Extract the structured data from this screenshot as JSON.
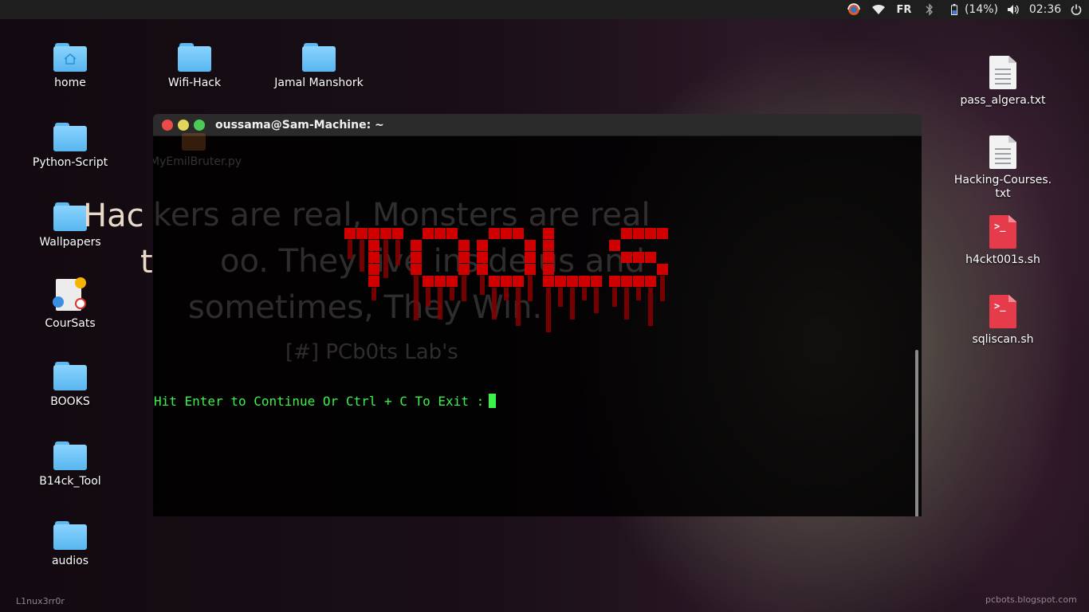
{
  "top_panel": {
    "keyboard_layout": "FR",
    "battery": "(14%)",
    "clock": "02:36"
  },
  "desktop_left": [
    {
      "label": "home",
      "icon": "home-folder-icon"
    },
    {
      "label": "Wifi-Hack",
      "icon": "folder-icon"
    },
    {
      "label": "Jamal Manshork",
      "icon": "folder-icon"
    },
    {
      "label": "Python-Script",
      "icon": "folder-icon"
    },
    {
      "label": "MyEmilBruter.py",
      "icon": "python-file-icon"
    },
    {
      "label": "Wallpapers",
      "icon": "folder-icon"
    },
    {
      "label": "CourSats",
      "icon": "locked-shared-file-icon"
    },
    {
      "label": "BOOKS",
      "icon": "folder-icon"
    },
    {
      "label": "B14ck_Tool",
      "icon": "folder-icon"
    },
    {
      "label": "audios",
      "icon": "folder-icon"
    }
  ],
  "desktop_right": [
    {
      "label": "pass_algera.txt",
      "icon": "text-file-icon"
    },
    {
      "label": "Hacking-Courses.",
      "label2": "txt",
      "icon": "text-file-icon"
    },
    {
      "label": "h4ckt001s.sh",
      "icon": "shell-script-icon"
    },
    {
      "label": "sqliscan.sh",
      "icon": "shell-script-icon"
    }
  ],
  "wallpaper": {
    "quote_line1_outside": "Hac",
    "quote_line1_inside": "kers are real, Monsters are real",
    "quote_line2_outside": "t",
    "quote_line2_inside": "oo. They live inside us and",
    "quote_line3": "sometimes, They Win.",
    "signature": "[#] PCb0ts Lab's",
    "corner_left": "L1nux3rr0r",
    "corner_right": "pcbots.blogspot.com"
  },
  "terminal": {
    "title": "oussama@Sam-Machine: ~",
    "banner_text": "TOOLS",
    "prompt": "Hit Enter to Continue Or Ctrl + C To Exit :",
    "colors": {
      "banner": "#d10000",
      "prompt": "#3cf24a"
    }
  }
}
